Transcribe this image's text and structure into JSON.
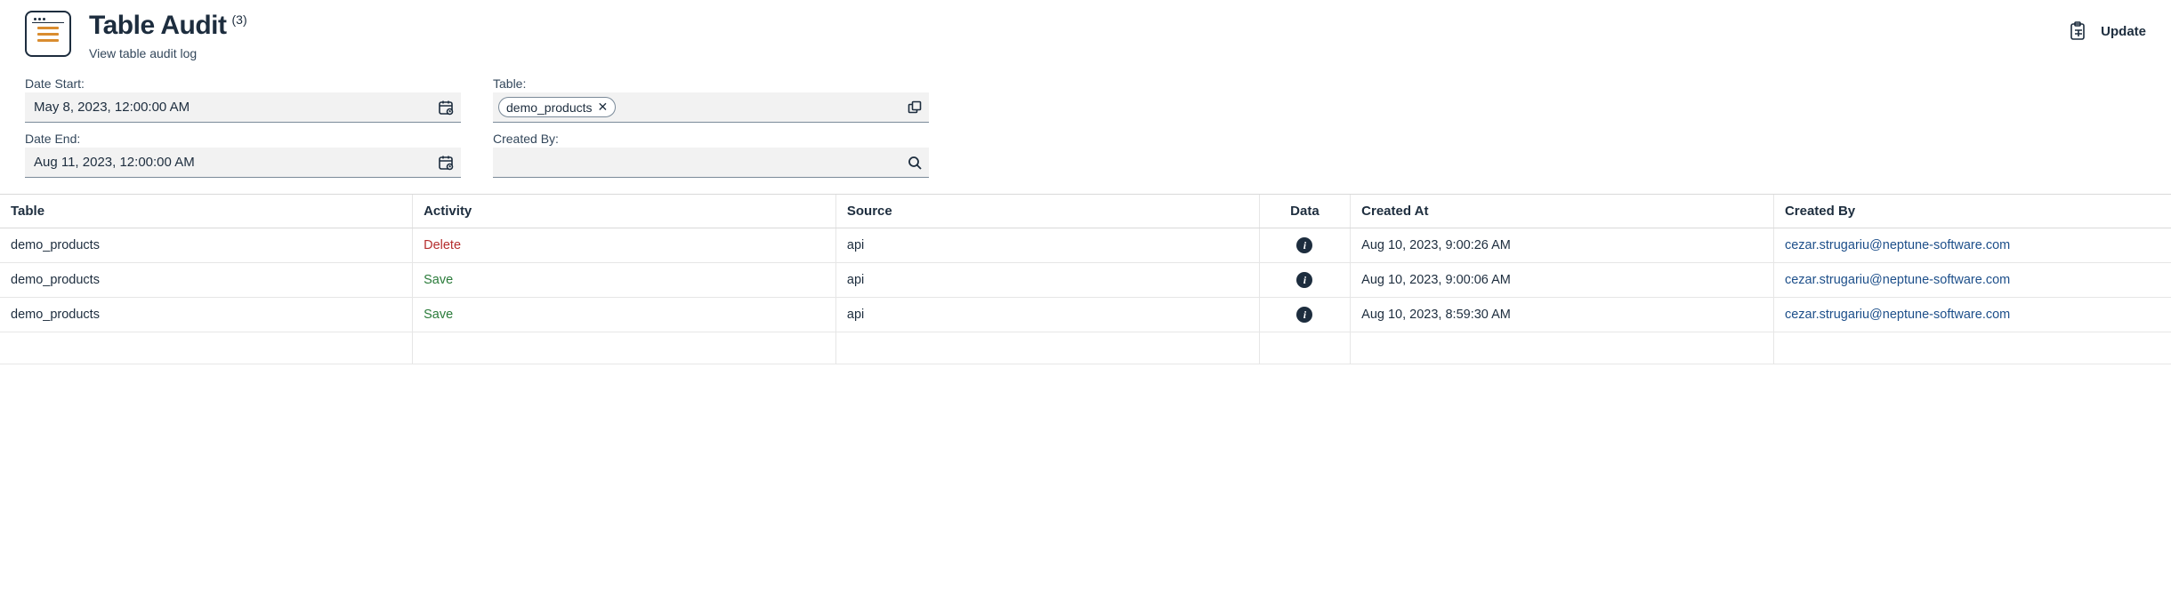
{
  "header": {
    "title": "Table Audit",
    "count_suffix": "(3)",
    "subtitle": "View table audit log",
    "update_label": "Update"
  },
  "filters": {
    "date_start": {
      "label": "Date Start:",
      "value": "May 8, 2023, 12:00:00 AM"
    },
    "date_end": {
      "label": "Date End:",
      "value": "Aug 11, 2023, 12:00:00 AM"
    },
    "table": {
      "label": "Table:",
      "token": "demo_products"
    },
    "created_by": {
      "label": "Created By:",
      "value": ""
    }
  },
  "table": {
    "columns": {
      "table": "Table",
      "activity": "Activity",
      "source": "Source",
      "data": "Data",
      "created_at": "Created At",
      "created_by": "Created By"
    },
    "rows": [
      {
        "table": "demo_products",
        "activity": "Delete",
        "activity_kind": "delete",
        "source": "api",
        "created_at": "Aug 10, 2023, 9:00:26 AM",
        "created_by": "cezar.strugariu@neptune-software.com"
      },
      {
        "table": "demo_products",
        "activity": "Save",
        "activity_kind": "save",
        "source": "api",
        "created_at": "Aug 10, 2023, 9:00:06 AM",
        "created_by": "cezar.strugariu@neptune-software.com"
      },
      {
        "table": "demo_products",
        "activity": "Save",
        "activity_kind": "save",
        "source": "api",
        "created_at": "Aug 10, 2023, 8:59:30 AM",
        "created_by": "cezar.strugariu@neptune-software.com"
      }
    ]
  }
}
